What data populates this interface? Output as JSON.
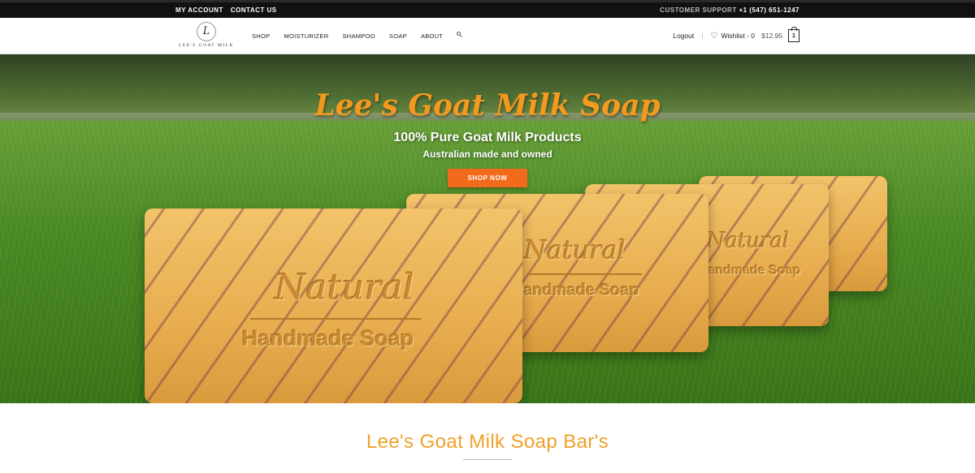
{
  "topbar": {
    "my_account": "MY ACCOUNT",
    "contact_us": "CONTACT US",
    "support_label": "CUSTOMER SUPPORT",
    "support_phone": "+1 (547) 651-1247"
  },
  "logo": {
    "initial": "L",
    "brand": "LEE'S GOAT MILK"
  },
  "menu": {
    "items": [
      "SHOP",
      "MOISTURIZER",
      "SHAMPOO",
      "SOAP",
      "ABOUT"
    ],
    "search_icon": "search-icon"
  },
  "account": {
    "logout": "Logout",
    "separator": "|",
    "wishlist": "Wishlist - 0",
    "price": "$12.95",
    "cart_count": "1",
    "heart_icon": "heart-icon",
    "cart_icon": "shopping-bag-icon"
  },
  "hero": {
    "title": "Lee's Goat Milk Soap",
    "subtitle": "100% Pure Goat Milk Products",
    "tagline": "Australian made and owned",
    "cta": "SHOP NOW",
    "soap_stamp": "Natural",
    "soap_stamp_2": "Handmade Soap",
    "cta_color": "#f26a1b",
    "title_color": "#f39a1e"
  },
  "section": {
    "title": "Lee's Goat Milk Soap Bar's",
    "title_color": "#f0a02a"
  }
}
